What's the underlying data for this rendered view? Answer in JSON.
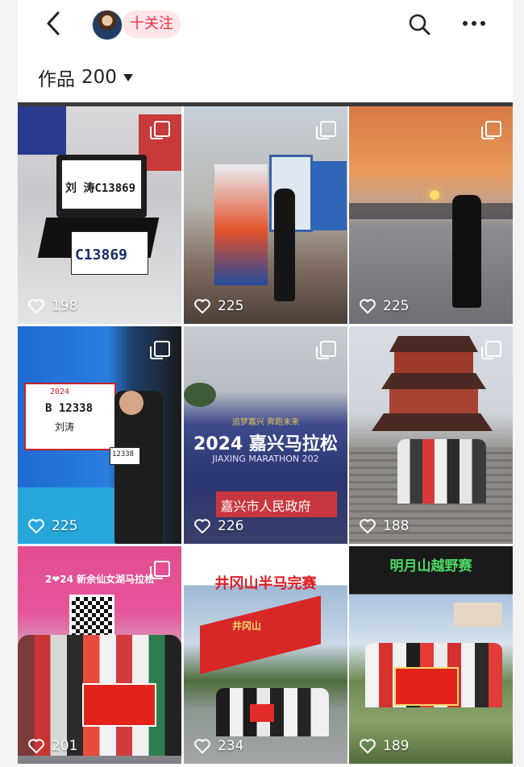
{
  "header": {
    "follow_label": "十关注"
  },
  "works": {
    "label": "作品",
    "count": "200"
  },
  "posts": [
    {
      "likes": "198",
      "bib": "C13869",
      "name": "刘  涛C13869"
    },
    {
      "likes": "225"
    },
    {
      "likes": "225"
    },
    {
      "likes": "225",
      "bib": "B 12338",
      "name": "刘涛",
      "bib_year": "2024",
      "chest_bib": "12338"
    },
    {
      "likes": "226",
      "banner_line1": "2024 嘉兴马拉松",
      "banner_line2": "JIAXING MARATHON 202",
      "banner_line3": "嘉兴市人民政府",
      "slogan": "追梦嘉兴  奔跑未来"
    },
    {
      "likes": "188"
    },
    {
      "likes": "201",
      "banner_line1": "2❤24 新余仙女湖马拉松"
    },
    {
      "likes": "234",
      "title": "井冈山半马完赛",
      "sculpture": "井冈山"
    },
    {
      "likes": "189",
      "title": "明月山越野赛"
    }
  ],
  "colors": {
    "accent": "#ef2d46",
    "follow_bg": "#fde6e8"
  }
}
